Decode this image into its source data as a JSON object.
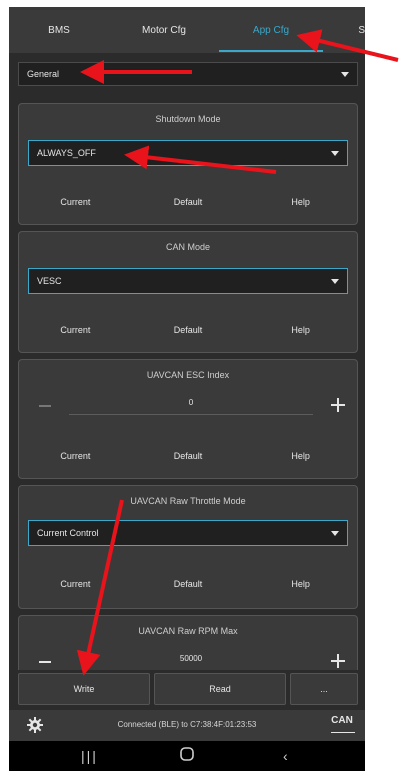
{
  "tabs": [
    "BMS",
    "Motor Cfg",
    "App Cfg",
    "S"
  ],
  "active_tab_index": 2,
  "section_select": {
    "value": "General"
  },
  "panels": [
    {
      "title": "Shutdown Mode",
      "type": "select",
      "value": "ALWAYS_OFF"
    },
    {
      "title": "CAN Mode",
      "type": "select",
      "value": "VESC"
    },
    {
      "title": "UAVCAN ESC Index",
      "type": "stepper",
      "value": "0"
    },
    {
      "title": "UAVCAN Raw Throttle Mode",
      "type": "select",
      "value": "Current Control"
    },
    {
      "title": "UAVCAN Raw RPM Max",
      "type": "stepper",
      "value": "50000"
    }
  ],
  "panel_buttons": {
    "current": "Current",
    "default": "Default",
    "help": "Help"
  },
  "bottom_buttons": {
    "write": "Write",
    "read": "Read",
    "more": "..."
  },
  "status": {
    "text": "Connected (BLE) to C7:38:4F:01:23:53",
    "can_label": "CAN"
  },
  "colors": {
    "accent": "#3ba7c9",
    "arrow": "#e8131b",
    "panel_bg": "#3a3a3a",
    "app_bg": "#2b2b2b"
  },
  "icons": {
    "settings": "gear-icon",
    "recents": "recents-icon",
    "home": "home-icon",
    "back": "back-icon"
  }
}
